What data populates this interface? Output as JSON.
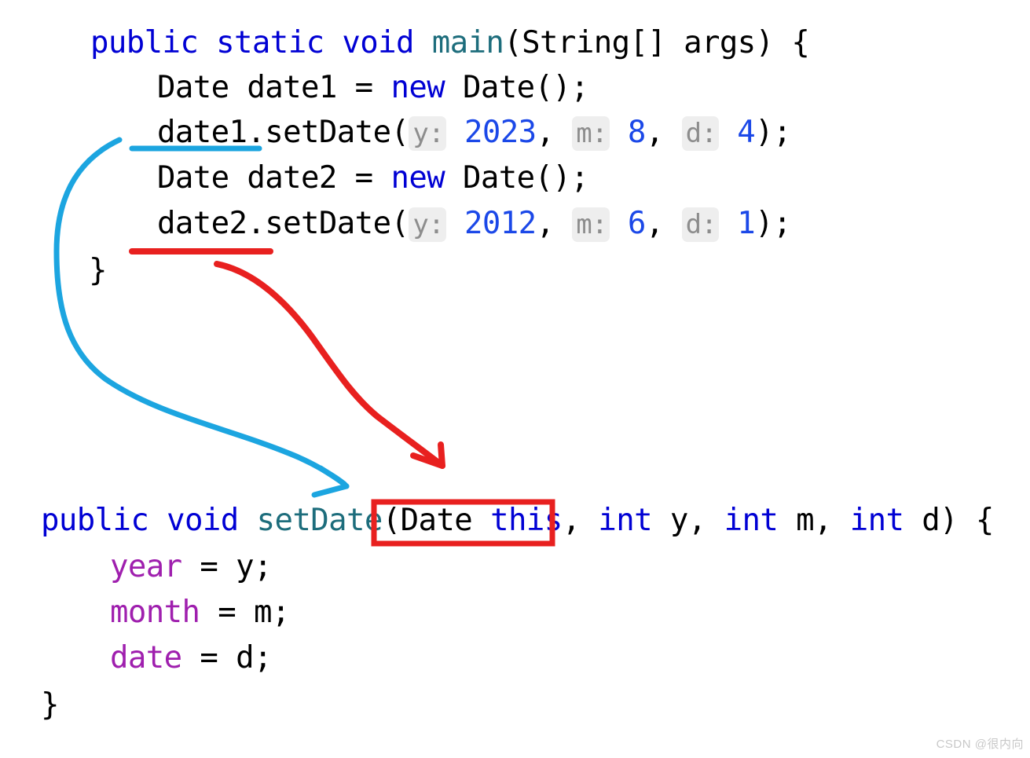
{
  "document": {
    "type": "java-code-annotated-screenshot",
    "background_color": "#ffffff"
  },
  "colors": {
    "keyword": "#0000d4",
    "method": "#1d6d7c",
    "field": "#9f1fae",
    "number": "#1b48e8",
    "plain_text": "#000000",
    "hint_text": "#8d8d8d",
    "hint_background": "#eeeeee",
    "annotation_blue": "#1ca5e0",
    "annotation_red": "#e8201f",
    "watermark": "#c8c8c8"
  },
  "code": {
    "top_block": {
      "line1": {
        "kw_public": "public",
        "kw_static": "static",
        "kw_void": "void",
        "method_main": "main",
        "rest": "(String[] args) {"
      },
      "line2": {
        "type_decl": "Date date1 = ",
        "kw_new": "new",
        "rest": " Date();"
      },
      "line3": {
        "receiver": "date1",
        "dot_method": ".setDate(",
        "hint_y": "y:",
        "value_y": "2023",
        "comma1": ", ",
        "hint_m": "m:",
        "value_m": "8",
        "comma2": ", ",
        "hint_d": "d:",
        "value_d": "4",
        "tail": ");"
      },
      "line4": {
        "type_decl": "Date date2 = ",
        "kw_new": "new",
        "rest": " Date();"
      },
      "line5": {
        "receiver": "date2",
        "dot_method": ".setDate(",
        "hint_y": "y:",
        "value_y": "2012",
        "comma1": ", ",
        "hint_m": "m:",
        "value_m": "6",
        "comma2": ", ",
        "hint_d": "d:",
        "value_d": "1",
        "tail": ");"
      },
      "line6": {
        "closing_brace": "}"
      }
    },
    "bottom_block": {
      "signature": {
        "kw_public": "public",
        "kw_void": "void",
        "method_setdate": "setDate",
        "open_paren": "(",
        "type_date": "Date",
        "space": " ",
        "kw_this": "this",
        "comma_after_this": ",",
        "kw_int1": " int",
        "param_y": " y, ",
        "kw_int2": "int",
        "param_m": " m, ",
        "kw_int3": "int",
        "param_d": " d) {"
      },
      "body": [
        {
          "field": "year",
          "assign": " = y;"
        },
        {
          "field": "month",
          "assign": " = m;"
        },
        {
          "field": "date",
          "assign": " = d;"
        }
      ],
      "closing_brace": "}"
    }
  },
  "annotations": {
    "blue_underline": {
      "name": "blue-underline-under-date1",
      "target_text": "date1",
      "color": "#1ca5e0"
    },
    "red_underline": {
      "name": "red-underline-under-date2",
      "target_text": "date2",
      "color": "#e8201f"
    },
    "blue_arrow": {
      "name": "blue-arrow-date1-to-this",
      "from": "date1 receiver",
      "to": "Date this parameter",
      "color": "#1ca5e0"
    },
    "red_arrow": {
      "name": "red-arrow-date2-to-this",
      "from": "date2 receiver",
      "to": "Date this parameter",
      "color": "#e8201f"
    },
    "red_box": {
      "name": "red-box-around-implicit-this-parameter",
      "enclosed_text": "(Date this,",
      "color": "#e8201f"
    }
  },
  "watermark": {
    "text": "CSDN @很内向"
  }
}
